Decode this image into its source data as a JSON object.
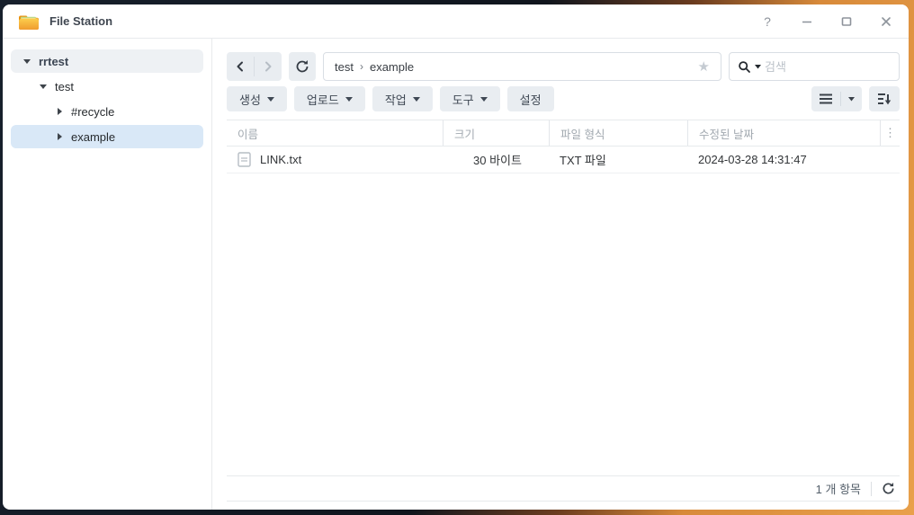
{
  "window": {
    "title": "File Station",
    "controls": {
      "help_label": "?"
    }
  },
  "sidebar": {
    "items": [
      {
        "label": "rrtest",
        "level": 0,
        "expanded": true,
        "selected": false,
        "root": true
      },
      {
        "label": "test",
        "level": 1,
        "expanded": true,
        "selected": false,
        "root": false
      },
      {
        "label": "#recycle",
        "level": 2,
        "expanded": false,
        "selected": false,
        "root": false
      },
      {
        "label": "example",
        "level": 2,
        "expanded": false,
        "selected": true,
        "root": false
      }
    ]
  },
  "nav": {
    "breadcrumb_parts": [
      "test",
      "example"
    ],
    "breadcrumb_separator": "›",
    "star_glyph": "★",
    "search_placeholder": "검색"
  },
  "toolbar": {
    "buttons": [
      {
        "label": "생성",
        "dropdown": true
      },
      {
        "label": "업로드",
        "dropdown": true
      },
      {
        "label": "작업",
        "dropdown": true
      },
      {
        "label": "도구",
        "dropdown": true
      },
      {
        "label": "설정",
        "dropdown": false
      }
    ]
  },
  "table": {
    "columns": [
      "이름",
      "크기",
      "파일 형식",
      "수정된 날짜"
    ],
    "header_menu_glyph": "⋮",
    "rows": [
      {
        "name": "LINK.txt",
        "size": "30 바이트",
        "type": "TXT 파일",
        "modified": "2024-03-28 14:31:47"
      }
    ]
  },
  "statusbar": {
    "items_count": "1 개 항목"
  },
  "colors": {
    "selected_tree_bg": "#d9e8f7",
    "root_tree_bg": "#eef1f4",
    "button_bg": "#e9edf1",
    "folder_icon_orange": "#f5a623",
    "header_text": "#a2a9b0",
    "border": "#e7eaec"
  }
}
